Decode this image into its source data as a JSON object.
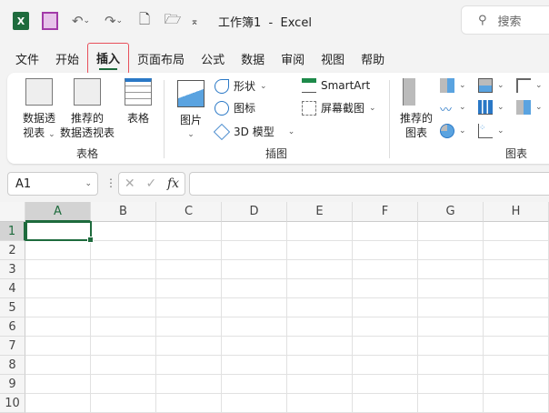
{
  "titlebar": {
    "title": "工作簿1  -  Excel",
    "search_placeholder": "搜索"
  },
  "tabs": [
    "文件",
    "开始",
    "插入",
    "页面布局",
    "公式",
    "数据",
    "审阅",
    "视图",
    "帮助"
  ],
  "active_tab": "插入",
  "ribbon": {
    "tables": {
      "pivot": "数据透",
      "pivot2": "视表",
      "rec_pivot": "推荐的",
      "rec_pivot2": "数据透视表",
      "table": "表格",
      "group": "表格"
    },
    "illustrations": {
      "pictures": "图片",
      "shapes": "形状",
      "icons": "图标",
      "model3d": "3D 模型",
      "smartart": "SmartArt",
      "screenshot": "屏幕截图",
      "group": "插图"
    },
    "charts": {
      "rec_charts": "推荐的",
      "rec_charts2": "图表",
      "group": "图表"
    }
  },
  "formula_bar": {
    "name_box": "A1",
    "fx": "fx",
    "value": ""
  },
  "grid": {
    "columns": [
      "A",
      "B",
      "C",
      "D",
      "E",
      "F",
      "G",
      "H"
    ],
    "rows": [
      "1",
      "2",
      "3",
      "4",
      "5",
      "6",
      "7",
      "8",
      "9",
      "10"
    ],
    "selected_cell": "A1"
  },
  "colors": {
    "accent": "#1e6b3d",
    "highlight": "#e8505b"
  }
}
